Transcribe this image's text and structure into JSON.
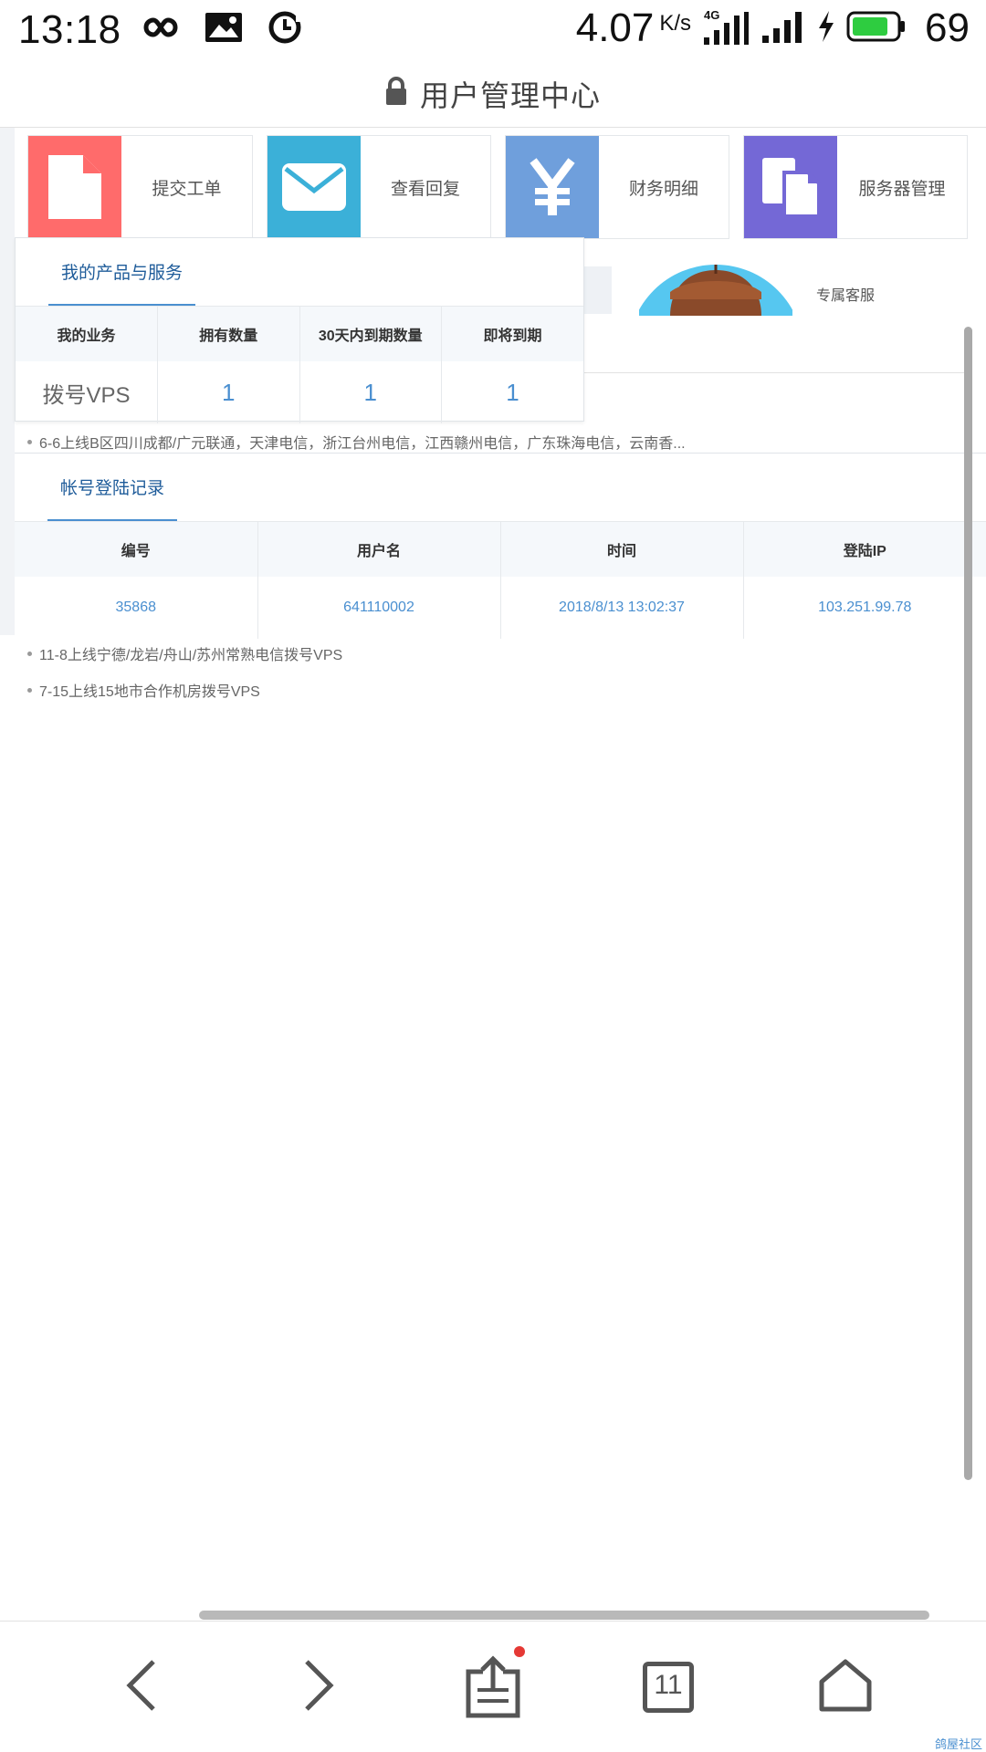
{
  "status_bar": {
    "time": "13:18",
    "speed": "4.07",
    "speed_unit": "K/s",
    "network": "4G",
    "battery": "69",
    "icons": [
      "infinity-icon",
      "image-icon",
      "timer-sync-icon",
      "signal-4g-icon",
      "signal-icon",
      "charging-icon",
      "battery-icon"
    ]
  },
  "browser": {
    "title": "用户管理中心",
    "tab_count": "11"
  },
  "tiles": [
    {
      "label": "提交工单",
      "color": "#ff6b6b",
      "icon": "document-icon"
    },
    {
      "label": "查看回复",
      "color": "#3bb0d8",
      "icon": "envelope-icon"
    },
    {
      "label": "财务明细",
      "color": "#6f9fdc",
      "icon": "yen-icon"
    },
    {
      "label": "服务器管理",
      "color": "#7468d6",
      "icon": "files-icon"
    }
  ],
  "support": {
    "label": "专属客服"
  },
  "products": {
    "tab": "我的产品与服务",
    "headers": [
      "我的业务",
      "拥有数量",
      "30天内到期数量",
      "即将到期"
    ],
    "rows": [
      [
        "拨号VPS",
        "1",
        "1",
        "1"
      ]
    ]
  },
  "news": [
    "6-6上线B区四川成都/广元联通，天津电信，浙江台州电信，江西赣州电信，广东珠海电信，云南香...",
    "11-8上线宁德/龙岩/舟山/苏州常熟电信拨号VPS",
    "7-15上线15地市合作机房拨号VPS"
  ],
  "logins": {
    "tab": "帐号登陆记录",
    "headers": [
      "编号",
      "用户名",
      "时间",
      "登陆IP"
    ],
    "rows": [
      [
        "35868",
        "641110002",
        "2018/8/13 13:02:37",
        "103.251.99.78"
      ]
    ]
  },
  "watermark": "鸽屋社区",
  "colors": {
    "accent": "#4a8fd0",
    "tab_text": "#1f5c9a",
    "notification_dot": "#e53935"
  }
}
